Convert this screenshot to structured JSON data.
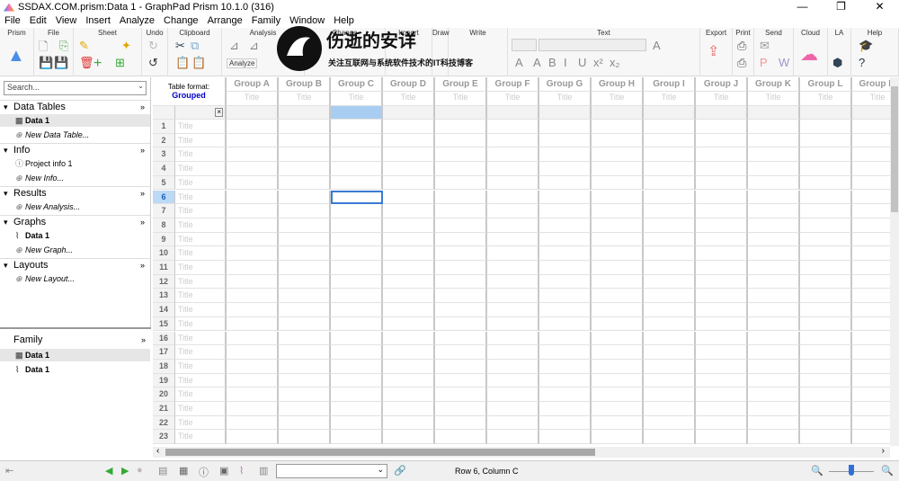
{
  "window": {
    "title": "SSDAX.COM.prism:Data 1 - GraphPad Prism 10.1.0 (316)",
    "minimize": "—",
    "restore": "❐",
    "close": "✕"
  },
  "menu": [
    "File",
    "Edit",
    "View",
    "Insert",
    "Analyze",
    "Change",
    "Arrange",
    "Family",
    "Window",
    "Help"
  ],
  "ribbon": {
    "groups": [
      "Prism",
      "File",
      "Sheet",
      "Undo",
      "Clipboard",
      "Analysis",
      "Change",
      "Import",
      "Draw",
      "Write",
      "Text",
      "Export",
      "Print",
      "Send",
      "Cloud",
      "LA",
      "Help"
    ],
    "analyze_label": "Analyze"
  },
  "watermark": {
    "title": "伤逝的安详",
    "subtitle": "关注互联网与系统软件技术的IT科技博客"
  },
  "sidebar": {
    "search_placeholder": "Search...",
    "sections": [
      {
        "label": "Data Tables",
        "items": [
          {
            "label": "Data 1",
            "bold": true
          },
          {
            "label": "New Data Table...",
            "italic": true
          }
        ]
      },
      {
        "label": "Info",
        "items": [
          {
            "label": "Project info 1"
          },
          {
            "label": "New Info...",
            "italic": true
          }
        ]
      },
      {
        "label": "Results",
        "items": [
          {
            "label": "New Analysis...",
            "italic": true
          }
        ]
      },
      {
        "label": "Graphs",
        "items": [
          {
            "label": "Data 1",
            "bold": true
          },
          {
            "label": "New Graph...",
            "italic": true
          }
        ]
      },
      {
        "label": "Layouts",
        "items": [
          {
            "label": "New Layout...",
            "italic": true
          }
        ]
      }
    ]
  },
  "family": {
    "label": "Family",
    "items": [
      "Data 1",
      "Data 1"
    ]
  },
  "table": {
    "format_label": "Table format:",
    "format": "Grouped",
    "row_title_placeholder": "Title",
    "columns": [
      "Group A",
      "Group B",
      "Group C",
      "Group D",
      "Group E",
      "Group F",
      "Group G",
      "Group H",
      "Group I",
      "Group J",
      "Group K",
      "Group L",
      "Group M"
    ],
    "column_title_placeholder": "Title",
    "rows": [
      "1",
      "2",
      "3",
      "4",
      "5",
      "6",
      "7",
      "8",
      "9",
      "10",
      "11",
      "12",
      "13",
      "14",
      "15",
      "16",
      "17",
      "18",
      "19",
      "20",
      "21",
      "22",
      "23"
    ],
    "selected": {
      "row": 6,
      "column": "C"
    }
  },
  "status": {
    "position": "Row 6, Column C",
    "zoom_level": 0.5
  },
  "colors": {
    "format": "#0000cc",
    "selection": "#a8cdf0",
    "selection_border": "#3a7bd5"
  }
}
